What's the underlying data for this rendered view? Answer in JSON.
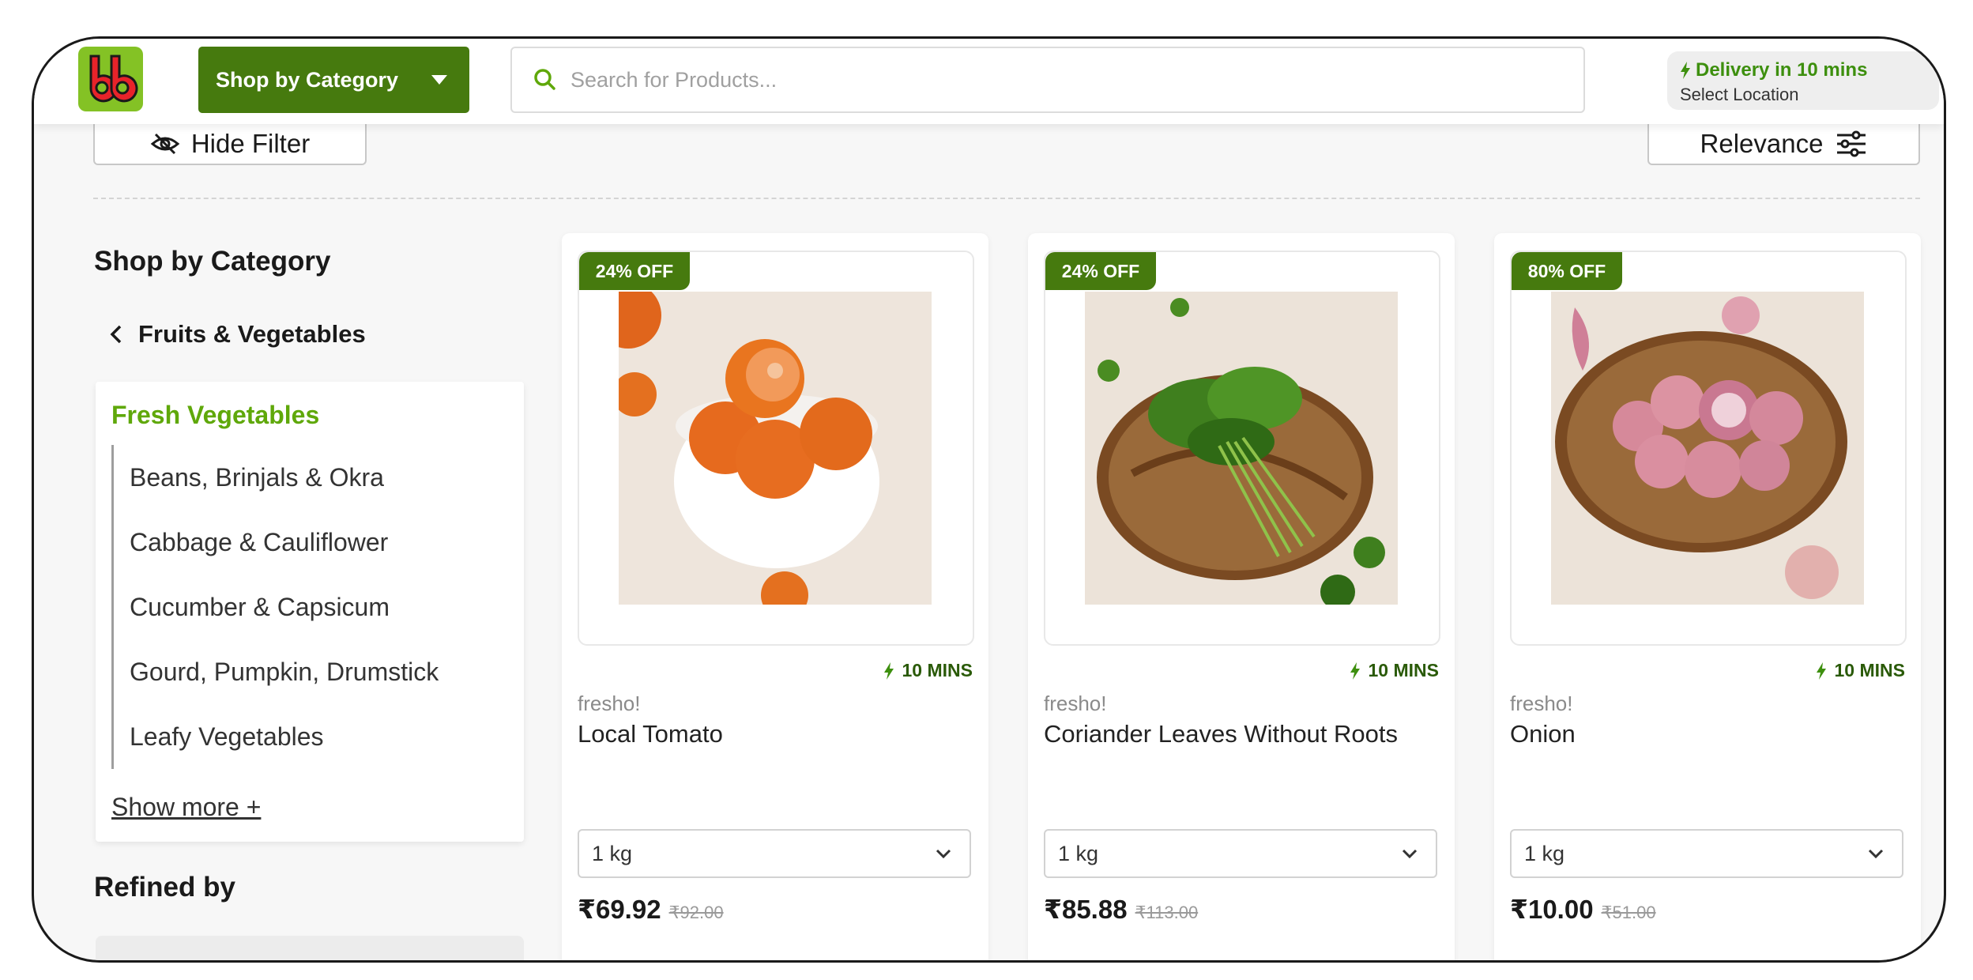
{
  "header": {
    "logo_text": "bb",
    "shop_by_category_label": "Shop by Category",
    "search_placeholder": "Search for Products...",
    "delivery_line1": "Delivery in 10 mins",
    "delivery_line2": "Select Location"
  },
  "toolbar": {
    "hide_filter_label": "Hide Filter",
    "sort_label": "Relevance"
  },
  "sidebar": {
    "title": "Shop by Category",
    "back_label": "Fruits & Vegetables",
    "active_category": "Fresh Vegetables",
    "items": [
      {
        "label": "Beans, Brinjals & Okra"
      },
      {
        "label": "Cabbage & Cauliflower"
      },
      {
        "label": "Cucumber & Capsicum"
      },
      {
        "label": "Gourd, Pumpkin, Drumstick"
      },
      {
        "label": "Leafy Vegetables"
      }
    ],
    "show_more_label": "Show more +",
    "refined_title": "Refined by"
  },
  "products": [
    {
      "badge": "24% OFF",
      "delivery": "10 MINS",
      "brand": "fresho!",
      "name": "Local Tomato",
      "qty": "1 kg",
      "price": "₹69.92",
      "mrp": "₹92.00"
    },
    {
      "badge": "24% OFF",
      "delivery": "10 MINS",
      "brand": "fresho!",
      "name": "Coriander Leaves Without Roots",
      "qty": "1 kg",
      "price": "₹85.88",
      "mrp": "₹113.00"
    },
    {
      "badge": "80% OFF",
      "delivery": "10 MINS",
      "brand": "fresho!",
      "name": "Onion",
      "qty": "1 kg",
      "price": "₹10.00",
      "mrp": "₹51.00"
    }
  ],
  "colors": {
    "brand_green": "#467a0e",
    "accent_green": "#84c225",
    "logo_red": "#e8232a"
  }
}
